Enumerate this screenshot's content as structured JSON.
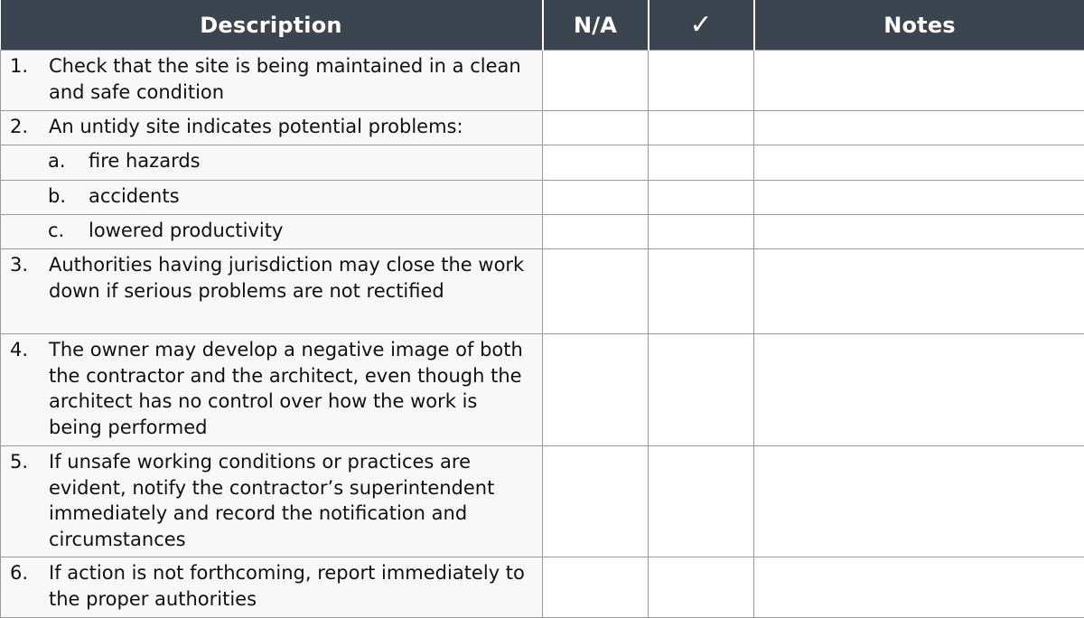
{
  "table": {
    "headers": {
      "description": "Description",
      "na": "N/A",
      "check": "✓",
      "notes": "Notes"
    },
    "rows": [
      {
        "number": "1.",
        "text": "Check that the site is being maintained in a clean and safe condition"
      },
      {
        "number": "2.",
        "text": "An untidy site indicates potential problems:"
      },
      {
        "number": "a.",
        "text": "fire hazards"
      },
      {
        "number": "b.",
        "text": "accidents"
      },
      {
        "number": "c.",
        "text": "lowered productivity"
      },
      {
        "number": "3.",
        "text": "Authorities having jurisdiction may close the work down if serious problems are not rectified"
      },
      {
        "number": "4.",
        "text": "The owner may develop a negative image of both the contractor and the architect, even though the architect has no control over how the work is being performed"
      },
      {
        "number": "5.",
        "text": "If unsafe working conditions or practices are evident, notify the contractor’s superintendent immediately and record the notification and circumstances"
      },
      {
        "number": "6.",
        "text": "If action is not forthcoming, report immediately to the proper authorities"
      }
    ]
  },
  "colors": {
    "header_bg": "#3b4550",
    "header_text": "#ffffff",
    "description_bg": "#f8f8f8",
    "grid_line": "#9a9a9a"
  }
}
